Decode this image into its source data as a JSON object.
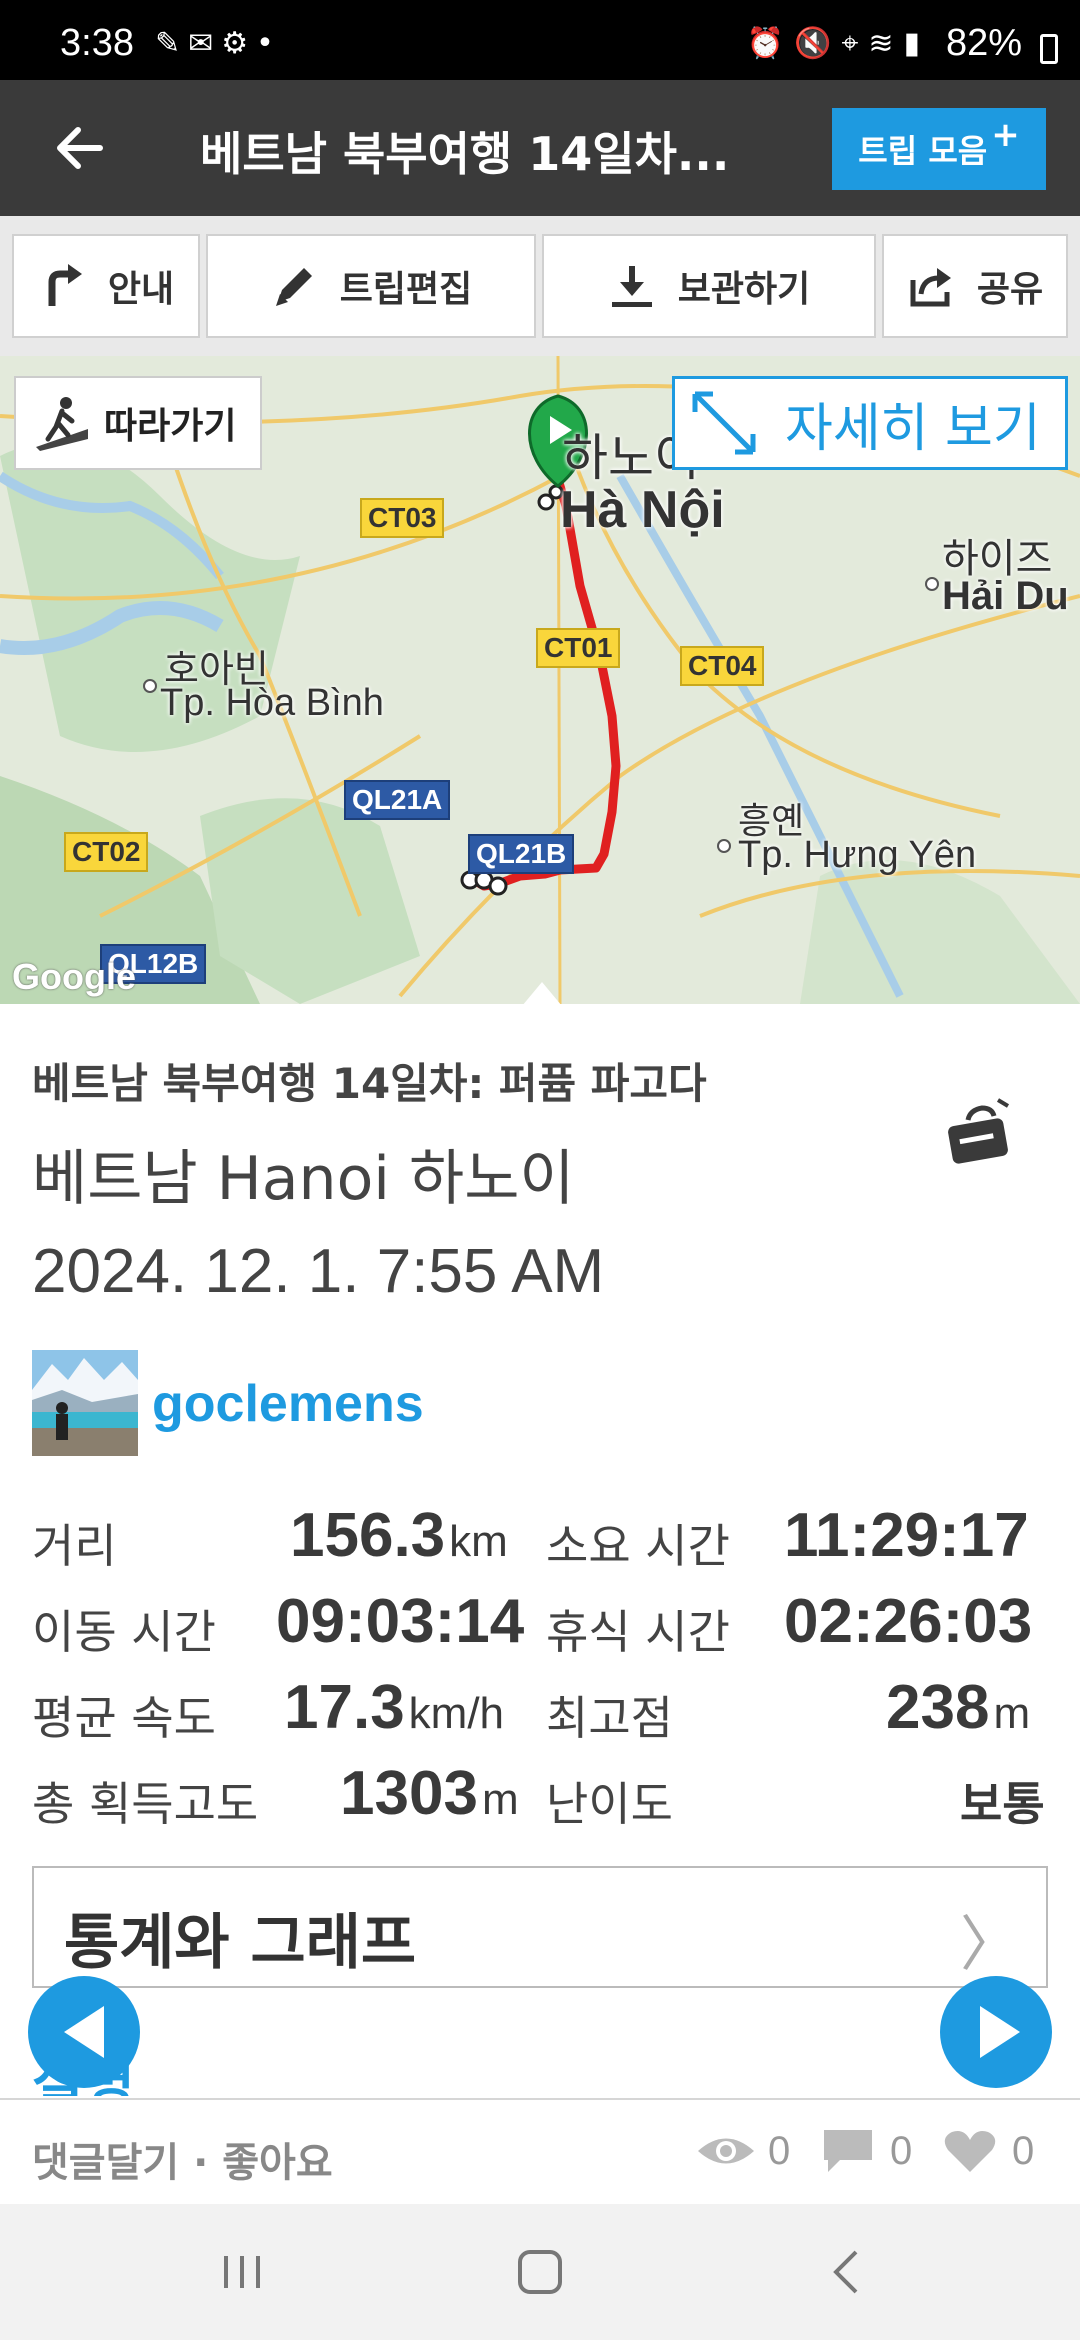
{
  "status_bar": {
    "time": "3:38",
    "battery": "82%"
  },
  "header": {
    "title": "베트남 북부여행 14일차...",
    "trip_collection_label": "트립 모음",
    "trip_collection_plus": "+"
  },
  "toolbar": {
    "guide": "안내",
    "edit": "트립편집",
    "archive": "보관하기",
    "share": "공유"
  },
  "map": {
    "follow_label": "따라가기",
    "detail_label": "자세히 보기",
    "places": [
      {
        "ko": "하노이",
        "vi": "Hà Nội"
      },
      {
        "ko": "하이즈",
        "vi": "Hải Du"
      },
      {
        "ko": "호아빈",
        "vi": "Tp. Hòa Bình"
      },
      {
        "ko": "흥옌",
        "vi": "Tp. Hưng Yên"
      }
    ],
    "roads": [
      "CT03",
      "CT01",
      "CT04",
      "QL21A",
      "QL21B",
      "CT02",
      "QL12B"
    ],
    "attribution": "Google"
  },
  "trip": {
    "subtitle": "베트남 북부여행 14일차: 퍼퓸 파고다",
    "location": "베트남 Hanoi 하노이",
    "date": "2024. 12. 1. 7:55 AM",
    "user": "goclemens"
  },
  "stats": {
    "distance_label": "거리",
    "distance_value": "156.3",
    "distance_unit": "km",
    "duration_label": "소요 시간",
    "duration_value": "11:29:17",
    "moving_label": "이동 시간",
    "moving_value": "09:03:14",
    "rest_label": "휴식 시간",
    "rest_value": "02:26:03",
    "avg_speed_label": "평균 속도",
    "avg_speed_value": "17.3",
    "avg_speed_unit": "km/h",
    "max_alt_label": "최고점",
    "max_alt_value": "238",
    "max_alt_unit": "m",
    "gain_label": "총 획득고도",
    "gain_value": "1303",
    "gain_unit": "m",
    "difficulty_label": "난이도",
    "difficulty_value": "보통"
  },
  "stats_graph": {
    "label": "통계와 그래프",
    "chevron": "〉"
  },
  "partial_section": "설명",
  "footer": {
    "actions": "댓글달기 · 좋아요",
    "views": "0",
    "comments": "0",
    "likes": "0"
  },
  "colors": {
    "accent": "#1e9ae0",
    "header_bg": "#3a3a3a",
    "route": "#e02020"
  }
}
